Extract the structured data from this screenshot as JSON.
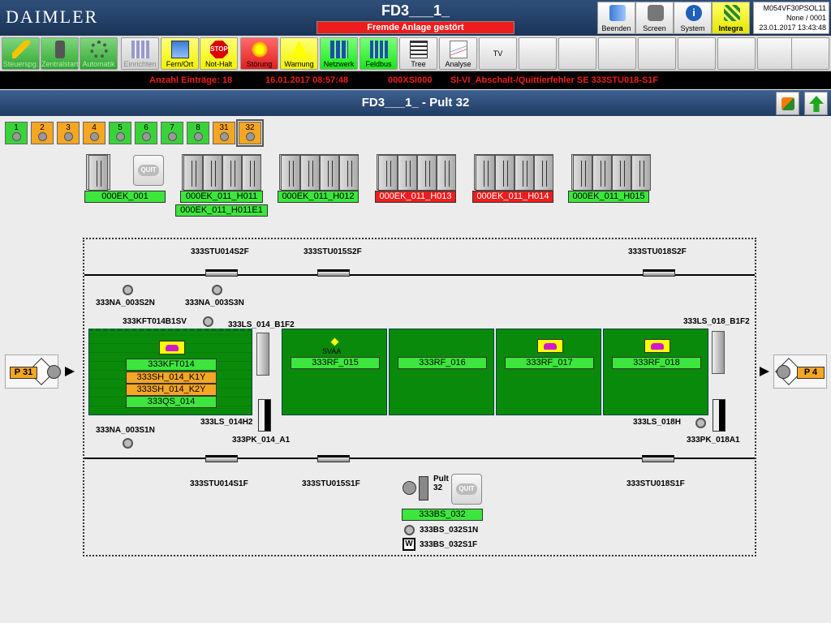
{
  "header": {
    "logo": "DAIMLER",
    "plant_title": "FD3___1_",
    "alarm_banner": "Fremde Anlage gestört",
    "top_buttons": [
      "Beenden",
      "Screen",
      "System",
      "Integra"
    ],
    "info": {
      "host": "M054VF30PSOL11",
      "user": "None / 0001",
      "datetime": "23.01.2017 13:43:48"
    }
  },
  "toolbar": {
    "buttons": [
      "Steuerspg.",
      "Zentralstart",
      "Automatik",
      "Einrichten",
      "Fern/Ort",
      "Not-Halt",
      "Störung",
      "Warnung",
      "Netzwerk",
      "Feldbus",
      "Tree",
      "Analyse",
      "TV"
    ]
  },
  "status": {
    "count": "Anzahl Einträge: 18",
    "timestamp": "16.01.2017 08:57:48",
    "code": "000XSI000",
    "message": "SI-VI_Abschalt-/Quittierfehler SE 333STU018-S1F"
  },
  "screen": {
    "title": "FD3___1_ - Pult 32",
    "pult_tabs": [
      "1",
      "2",
      "3",
      "4",
      "5",
      "6",
      "7",
      "8",
      "31",
      "32"
    ]
  },
  "cabinets": {
    "labels": [
      "000EK_001",
      "000EK_011_H011",
      "000EK_011_H012",
      "000EK_011_H013",
      "000EK_011_H014",
      "000EK_011_H015"
    ],
    "extra_label": "000EK_011_H011E1"
  },
  "line": {
    "sensors_top": [
      "333STU014S2F",
      "333STU015S2F",
      "333STU018S2F"
    ],
    "sensors_bottom": [
      "333STU014S1F",
      "333STU015S1F",
      "333STU018S1F"
    ],
    "tags": {
      "na_s2n": "333NA_003S2N",
      "na_s3n": "333NA_003S3N",
      "kft_sv": "333KFT014B1SV",
      "ls014_b1f2": "333LS_014_B1F2",
      "ls018_b1f2": "333LS_018_B1F2",
      "na_s1n": "333NA_003S1N",
      "ls014_h2": "333LS_014H2",
      "pk014": "333PK_014_A1",
      "ls018_h": "333LS_018H",
      "pk018": "333PK_018A1",
      "svaa": "SVAA"
    },
    "zone1_labels": [
      "333KFT014",
      "333SH_014_K1Y",
      "333SH_014_K2Y",
      "333QS_014"
    ],
    "zone_labels": [
      "333RF_015",
      "333RF_016",
      "333RF_017",
      "333RF_018"
    ],
    "left_node": "P 31",
    "right_node": "P 4"
  },
  "pult": {
    "name": "Pult",
    "number": "32",
    "label": "333BS_032",
    "sub1": "333BS_032S1N",
    "sub2": "333BS_032S1F",
    "w_mark": "W"
  },
  "colors": {
    "ok": "#3ce63c",
    "fault": "#ee1d1d",
    "warn": "#f5a623",
    "zone": "#0a8a0a"
  }
}
